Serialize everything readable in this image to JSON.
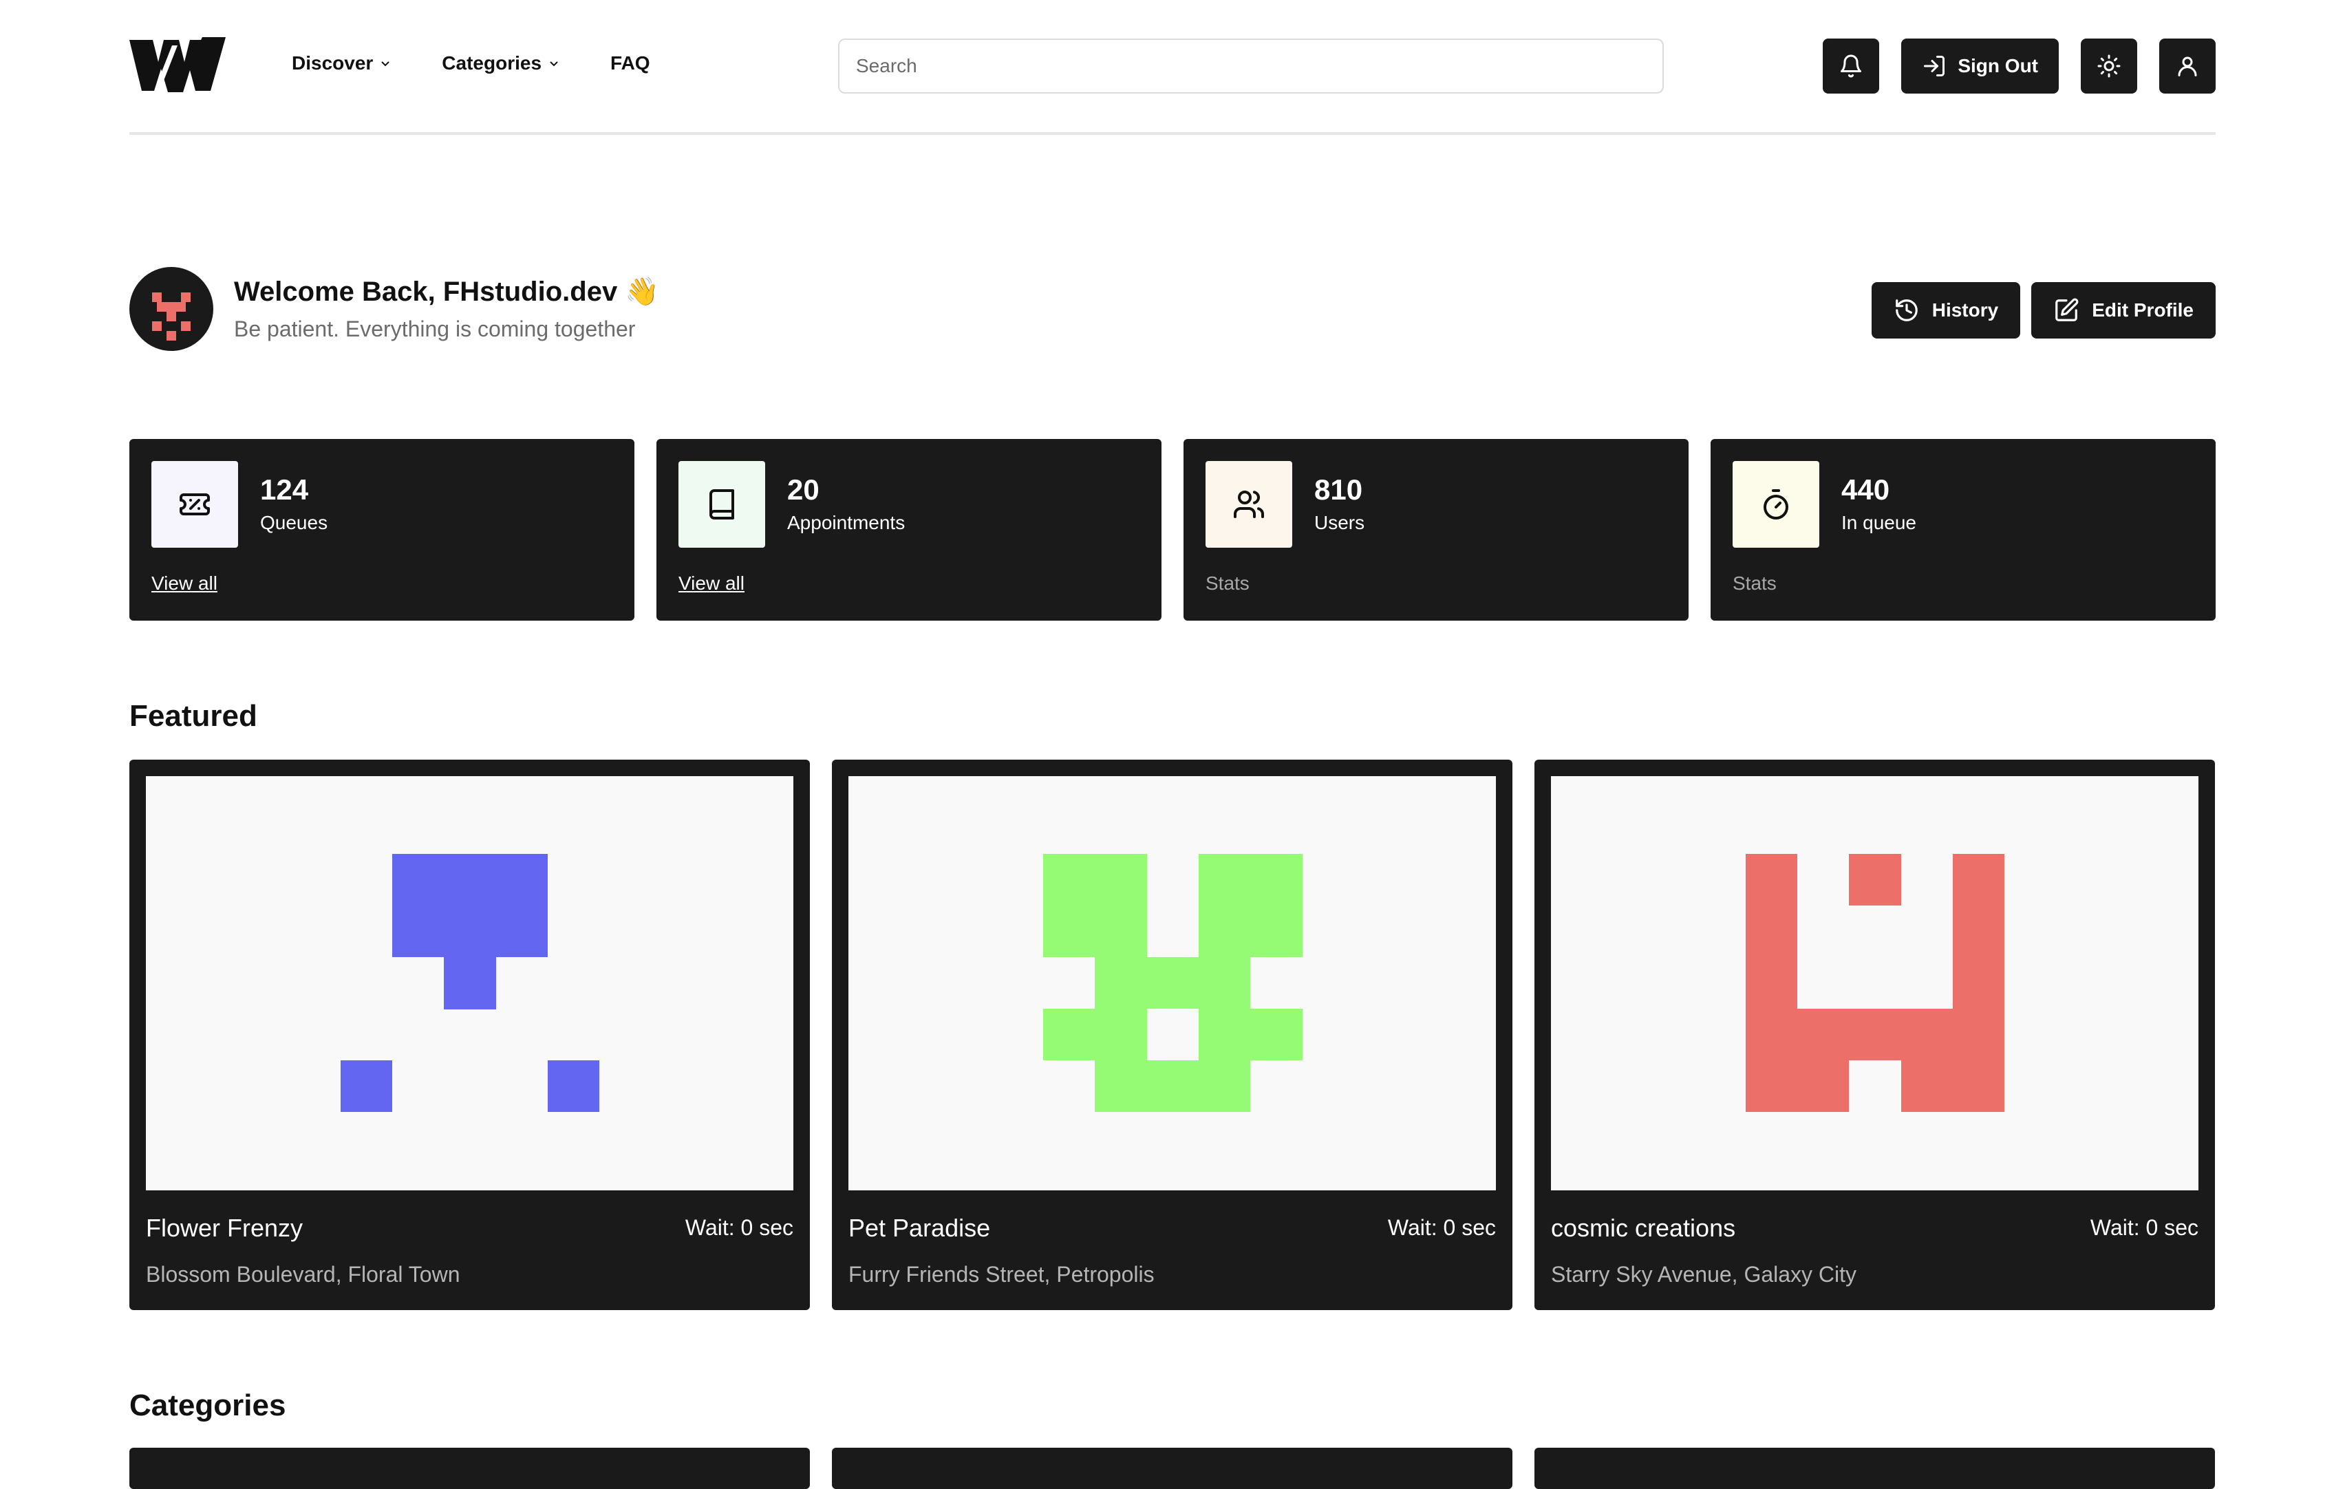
{
  "header": {
    "logo": "w-logo",
    "nav": [
      {
        "label": "Discover",
        "has_dropdown": true
      },
      {
        "label": "Categories",
        "has_dropdown": true
      },
      {
        "label": "FAQ",
        "has_dropdown": false
      }
    ],
    "search": {
      "placeholder": "Search",
      "value": ""
    },
    "buttons": {
      "notifications_icon": "bell-icon",
      "sign_out_label": "Sign Out",
      "theme_icon": "sun-icon",
      "profile_icon": "user-icon"
    }
  },
  "welcome": {
    "title": "Welcome Back, FHstudio.dev 👋",
    "subtitle": "Be patient. Everything is coming together",
    "history_label": "History",
    "edit_profile_label": "Edit Profile"
  },
  "stats": [
    {
      "value": "124",
      "label": "Queues",
      "footer": "View all",
      "footer_is_link": true,
      "icon": "ticket-icon",
      "icon_bg": "#f6f4fd"
    },
    {
      "value": "20",
      "label": "Appointments",
      "footer": "View all",
      "footer_is_link": true,
      "icon": "book-icon",
      "icon_bg": "#eefaf2"
    },
    {
      "value": "810",
      "label": "Users",
      "footer": "Stats",
      "footer_is_link": false,
      "icon": "users-icon",
      "icon_bg": "#fdf6ec"
    },
    {
      "value": "440",
      "label": "In queue",
      "footer": "Stats",
      "footer_is_link": false,
      "icon": "timer-icon",
      "icon_bg": "#fdfbe9"
    }
  ],
  "featured": {
    "title": "Featured",
    "cards": [
      {
        "name": "Flower Frenzy",
        "wait": "Wait: 0 sec",
        "address": "Blossom Boulevard, Floral Town",
        "color": "#6366f1"
      },
      {
        "name": "Pet Paradise",
        "wait": "Wait: 0 sec",
        "address": "Furry Friends Street, Petropolis",
        "color": "#95fb74"
      },
      {
        "name": "cosmic creations",
        "wait": "Wait: 0 sec",
        "address": "Starry Sky Avenue, Galaxy City",
        "color": "#ec7069"
      }
    ]
  },
  "categories": {
    "title": "Categories"
  },
  "colors": {
    "dark": "#1a1a1a",
    "page_bg": "#ffffff",
    "avatar_accent": "#ec7069"
  }
}
